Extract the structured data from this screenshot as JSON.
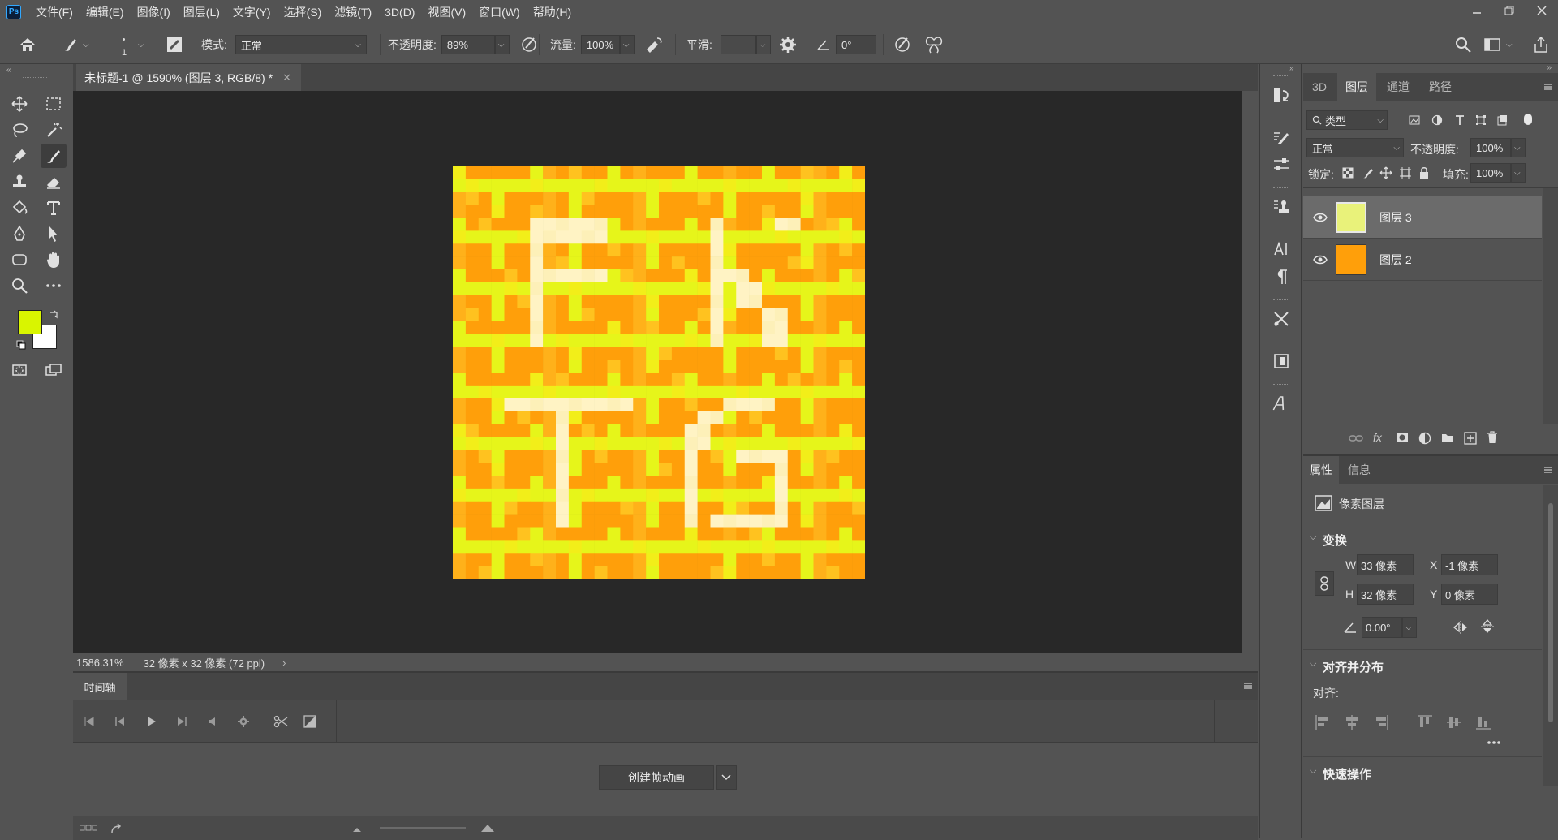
{
  "app": {
    "logo": "Ps"
  },
  "menu": [
    "文件(F)",
    "编辑(E)",
    "图像(I)",
    "图层(L)",
    "文字(Y)",
    "选择(S)",
    "滤镜(T)",
    "3D(D)",
    "视图(V)",
    "窗口(W)",
    "帮助(H)"
  ],
  "options": {
    "brush_size": "1",
    "mode_label": "模式:",
    "mode_value": "正常",
    "opacity_label": "不透明度:",
    "opacity_value": "89%",
    "flow_label": "流量:",
    "flow_value": "100%",
    "smooth_label": "平滑:",
    "smooth_value": "",
    "angle_value": "0°"
  },
  "document": {
    "tab_title": "未标题-1 @ 1590% (图层 3, RGB/8) *",
    "zoom": "1586.31%",
    "size_info": "32 像素 x 32 像素 (72 ppi)",
    "palette": [
      "#ff9f0a",
      "#ffb11a",
      "#ffc21f",
      "#e6f51a",
      "#f2ee19",
      "#fff3c4",
      "#fdf0b8"
    ]
  },
  "timeline": {
    "tab": "时间轴",
    "create_button": "创建帧动画"
  },
  "layers_panel": {
    "tabs": [
      "3D",
      "图层",
      "通道",
      "路径"
    ],
    "active_tab": "图层",
    "filter_label": "类型",
    "blend_mode": "正常",
    "opacity_label": "不透明度:",
    "opacity_value": "100%",
    "lock_label": "锁定:",
    "fill_label": "填充:",
    "fill_value": "100%",
    "layers": [
      {
        "name": "图层 3",
        "selected": true,
        "thumb_color": "#e9f27a"
      },
      {
        "name": "图层 2",
        "selected": false,
        "thumb_color": "#ff9f0a"
      }
    ]
  },
  "properties_panel": {
    "tabs": [
      "属性",
      "信息"
    ],
    "active_tab": "属性",
    "type_label": "像素图层",
    "transform_title": "变换",
    "w_label": "W",
    "w_value": "33 像素",
    "h_label": "H",
    "h_value": "32 像素",
    "x_label": "X",
    "x_value": "-1 像素",
    "y_label": "Y",
    "y_value": "0 像素",
    "angle_value": "0.00°",
    "align_title": "对齐并分布",
    "align_label": "对齐:",
    "quick_actions_title": "快速操作"
  },
  "colors": {
    "foreground": "#d9f500",
    "background": "#ffffff",
    "canvas_bg": "#282828",
    "panel_bg": "#535353"
  }
}
